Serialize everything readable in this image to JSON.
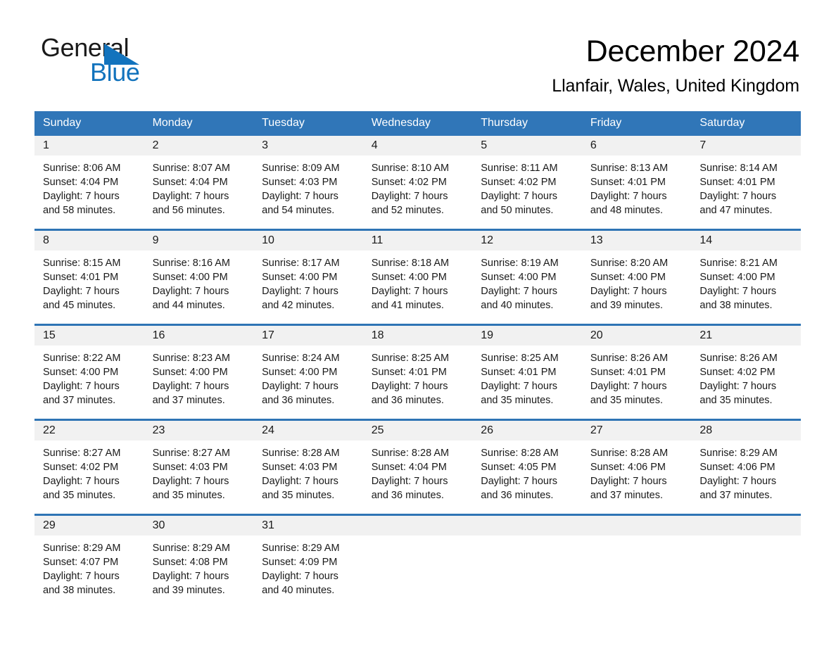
{
  "brand": {
    "name_part1": "General",
    "name_part2": "Blue",
    "logo_icon": "triangle-icon",
    "accent_color": "#1273bd"
  },
  "header": {
    "month_title": "December 2024",
    "location": "Llanfair, Wales, United Kingdom"
  },
  "theme": {
    "header_bg": "#3076b8",
    "divider": "#2e74b5",
    "daynum_bg": "#f1f1f1"
  },
  "calendar": {
    "weekday_headers": [
      "Sunday",
      "Monday",
      "Tuesday",
      "Wednesday",
      "Thursday",
      "Friday",
      "Saturday"
    ],
    "weeks": [
      {
        "days": [
          {
            "num": "1",
            "sunrise": "Sunrise: 8:06 AM",
            "sunset": "Sunset: 4:04 PM",
            "daylight1": "Daylight: 7 hours",
            "daylight2": "and 58 minutes."
          },
          {
            "num": "2",
            "sunrise": "Sunrise: 8:07 AM",
            "sunset": "Sunset: 4:04 PM",
            "daylight1": "Daylight: 7 hours",
            "daylight2": "and 56 minutes."
          },
          {
            "num": "3",
            "sunrise": "Sunrise: 8:09 AM",
            "sunset": "Sunset: 4:03 PM",
            "daylight1": "Daylight: 7 hours",
            "daylight2": "and 54 minutes."
          },
          {
            "num": "4",
            "sunrise": "Sunrise: 8:10 AM",
            "sunset": "Sunset: 4:02 PM",
            "daylight1": "Daylight: 7 hours",
            "daylight2": "and 52 minutes."
          },
          {
            "num": "5",
            "sunrise": "Sunrise: 8:11 AM",
            "sunset": "Sunset: 4:02 PM",
            "daylight1": "Daylight: 7 hours",
            "daylight2": "and 50 minutes."
          },
          {
            "num": "6",
            "sunrise": "Sunrise: 8:13 AM",
            "sunset": "Sunset: 4:01 PM",
            "daylight1": "Daylight: 7 hours",
            "daylight2": "and 48 minutes."
          },
          {
            "num": "7",
            "sunrise": "Sunrise: 8:14 AM",
            "sunset": "Sunset: 4:01 PM",
            "daylight1": "Daylight: 7 hours",
            "daylight2": "and 47 minutes."
          }
        ]
      },
      {
        "days": [
          {
            "num": "8",
            "sunrise": "Sunrise: 8:15 AM",
            "sunset": "Sunset: 4:01 PM",
            "daylight1": "Daylight: 7 hours",
            "daylight2": "and 45 minutes."
          },
          {
            "num": "9",
            "sunrise": "Sunrise: 8:16 AM",
            "sunset": "Sunset: 4:00 PM",
            "daylight1": "Daylight: 7 hours",
            "daylight2": "and 44 minutes."
          },
          {
            "num": "10",
            "sunrise": "Sunrise: 8:17 AM",
            "sunset": "Sunset: 4:00 PM",
            "daylight1": "Daylight: 7 hours",
            "daylight2": "and 42 minutes."
          },
          {
            "num": "11",
            "sunrise": "Sunrise: 8:18 AM",
            "sunset": "Sunset: 4:00 PM",
            "daylight1": "Daylight: 7 hours",
            "daylight2": "and 41 minutes."
          },
          {
            "num": "12",
            "sunrise": "Sunrise: 8:19 AM",
            "sunset": "Sunset: 4:00 PM",
            "daylight1": "Daylight: 7 hours",
            "daylight2": "and 40 minutes."
          },
          {
            "num": "13",
            "sunrise": "Sunrise: 8:20 AM",
            "sunset": "Sunset: 4:00 PM",
            "daylight1": "Daylight: 7 hours",
            "daylight2": "and 39 minutes."
          },
          {
            "num": "14",
            "sunrise": "Sunrise: 8:21 AM",
            "sunset": "Sunset: 4:00 PM",
            "daylight1": "Daylight: 7 hours",
            "daylight2": "and 38 minutes."
          }
        ]
      },
      {
        "days": [
          {
            "num": "15",
            "sunrise": "Sunrise: 8:22 AM",
            "sunset": "Sunset: 4:00 PM",
            "daylight1": "Daylight: 7 hours",
            "daylight2": "and 37 minutes."
          },
          {
            "num": "16",
            "sunrise": "Sunrise: 8:23 AM",
            "sunset": "Sunset: 4:00 PM",
            "daylight1": "Daylight: 7 hours",
            "daylight2": "and 37 minutes."
          },
          {
            "num": "17",
            "sunrise": "Sunrise: 8:24 AM",
            "sunset": "Sunset: 4:00 PM",
            "daylight1": "Daylight: 7 hours",
            "daylight2": "and 36 minutes."
          },
          {
            "num": "18",
            "sunrise": "Sunrise: 8:25 AM",
            "sunset": "Sunset: 4:01 PM",
            "daylight1": "Daylight: 7 hours",
            "daylight2": "and 36 minutes."
          },
          {
            "num": "19",
            "sunrise": "Sunrise: 8:25 AM",
            "sunset": "Sunset: 4:01 PM",
            "daylight1": "Daylight: 7 hours",
            "daylight2": "and 35 minutes."
          },
          {
            "num": "20",
            "sunrise": "Sunrise: 8:26 AM",
            "sunset": "Sunset: 4:01 PM",
            "daylight1": "Daylight: 7 hours",
            "daylight2": "and 35 minutes."
          },
          {
            "num": "21",
            "sunrise": "Sunrise: 8:26 AM",
            "sunset": "Sunset: 4:02 PM",
            "daylight1": "Daylight: 7 hours",
            "daylight2": "and 35 minutes."
          }
        ]
      },
      {
        "days": [
          {
            "num": "22",
            "sunrise": "Sunrise: 8:27 AM",
            "sunset": "Sunset: 4:02 PM",
            "daylight1": "Daylight: 7 hours",
            "daylight2": "and 35 minutes."
          },
          {
            "num": "23",
            "sunrise": "Sunrise: 8:27 AM",
            "sunset": "Sunset: 4:03 PM",
            "daylight1": "Daylight: 7 hours",
            "daylight2": "and 35 minutes."
          },
          {
            "num": "24",
            "sunrise": "Sunrise: 8:28 AM",
            "sunset": "Sunset: 4:03 PM",
            "daylight1": "Daylight: 7 hours",
            "daylight2": "and 35 minutes."
          },
          {
            "num": "25",
            "sunrise": "Sunrise: 8:28 AM",
            "sunset": "Sunset: 4:04 PM",
            "daylight1": "Daylight: 7 hours",
            "daylight2": "and 36 minutes."
          },
          {
            "num": "26",
            "sunrise": "Sunrise: 8:28 AM",
            "sunset": "Sunset: 4:05 PM",
            "daylight1": "Daylight: 7 hours",
            "daylight2": "and 36 minutes."
          },
          {
            "num": "27",
            "sunrise": "Sunrise: 8:28 AM",
            "sunset": "Sunset: 4:06 PM",
            "daylight1": "Daylight: 7 hours",
            "daylight2": "and 37 minutes."
          },
          {
            "num": "28",
            "sunrise": "Sunrise: 8:29 AM",
            "sunset": "Sunset: 4:06 PM",
            "daylight1": "Daylight: 7 hours",
            "daylight2": "and 37 minutes."
          }
        ]
      },
      {
        "days": [
          {
            "num": "29",
            "sunrise": "Sunrise: 8:29 AM",
            "sunset": "Sunset: 4:07 PM",
            "daylight1": "Daylight: 7 hours",
            "daylight2": "and 38 minutes."
          },
          {
            "num": "30",
            "sunrise": "Sunrise: 8:29 AM",
            "sunset": "Sunset: 4:08 PM",
            "daylight1": "Daylight: 7 hours",
            "daylight2": "and 39 minutes."
          },
          {
            "num": "31",
            "sunrise": "Sunrise: 8:29 AM",
            "sunset": "Sunset: 4:09 PM",
            "daylight1": "Daylight: 7 hours",
            "daylight2": "and 40 minutes."
          },
          {
            "num": "",
            "sunrise": "",
            "sunset": "",
            "daylight1": "",
            "daylight2": ""
          },
          {
            "num": "",
            "sunrise": "",
            "sunset": "",
            "daylight1": "",
            "daylight2": ""
          },
          {
            "num": "",
            "sunrise": "",
            "sunset": "",
            "daylight1": "",
            "daylight2": ""
          },
          {
            "num": "",
            "sunrise": "",
            "sunset": "",
            "daylight1": "",
            "daylight2": ""
          }
        ]
      }
    ]
  }
}
